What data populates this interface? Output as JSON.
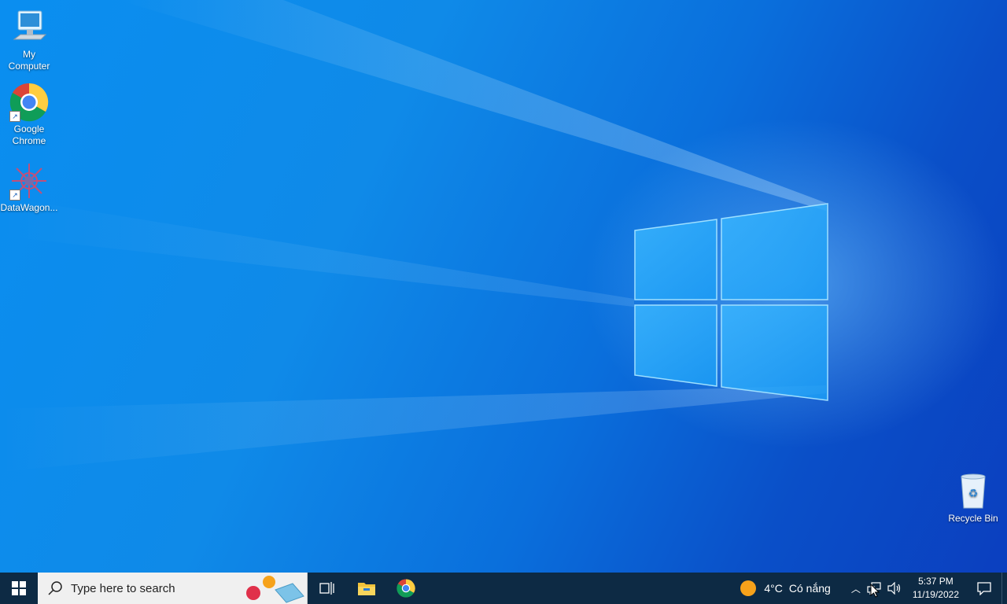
{
  "desktop": {
    "icons": [
      {
        "label_line1": "My",
        "label_line2": "Computer"
      },
      {
        "label_line1": "Google",
        "label_line2": "Chrome"
      },
      {
        "label_line1": "DataWagon...",
        "label_line2": ""
      }
    ],
    "recycle_bin": {
      "label": "Recycle Bin"
    }
  },
  "taskbar": {
    "search_placeholder": "Type here to search",
    "weather": {
      "temp": "4°C",
      "condition": "Có nắng"
    },
    "clock": {
      "time": "5:37 PM",
      "date": "11/19/2022"
    },
    "icons": [
      "windows-start-icon",
      "search-icon",
      "task-view-icon",
      "file-explorer-icon",
      "chrome-icon",
      "sun-icon",
      "chevron-up-icon",
      "network-icon",
      "volume-icon",
      "notification-icon"
    ]
  },
  "colors": {
    "desktop_blue": "#0a8ef0",
    "taskbar": "#0d2a44"
  }
}
